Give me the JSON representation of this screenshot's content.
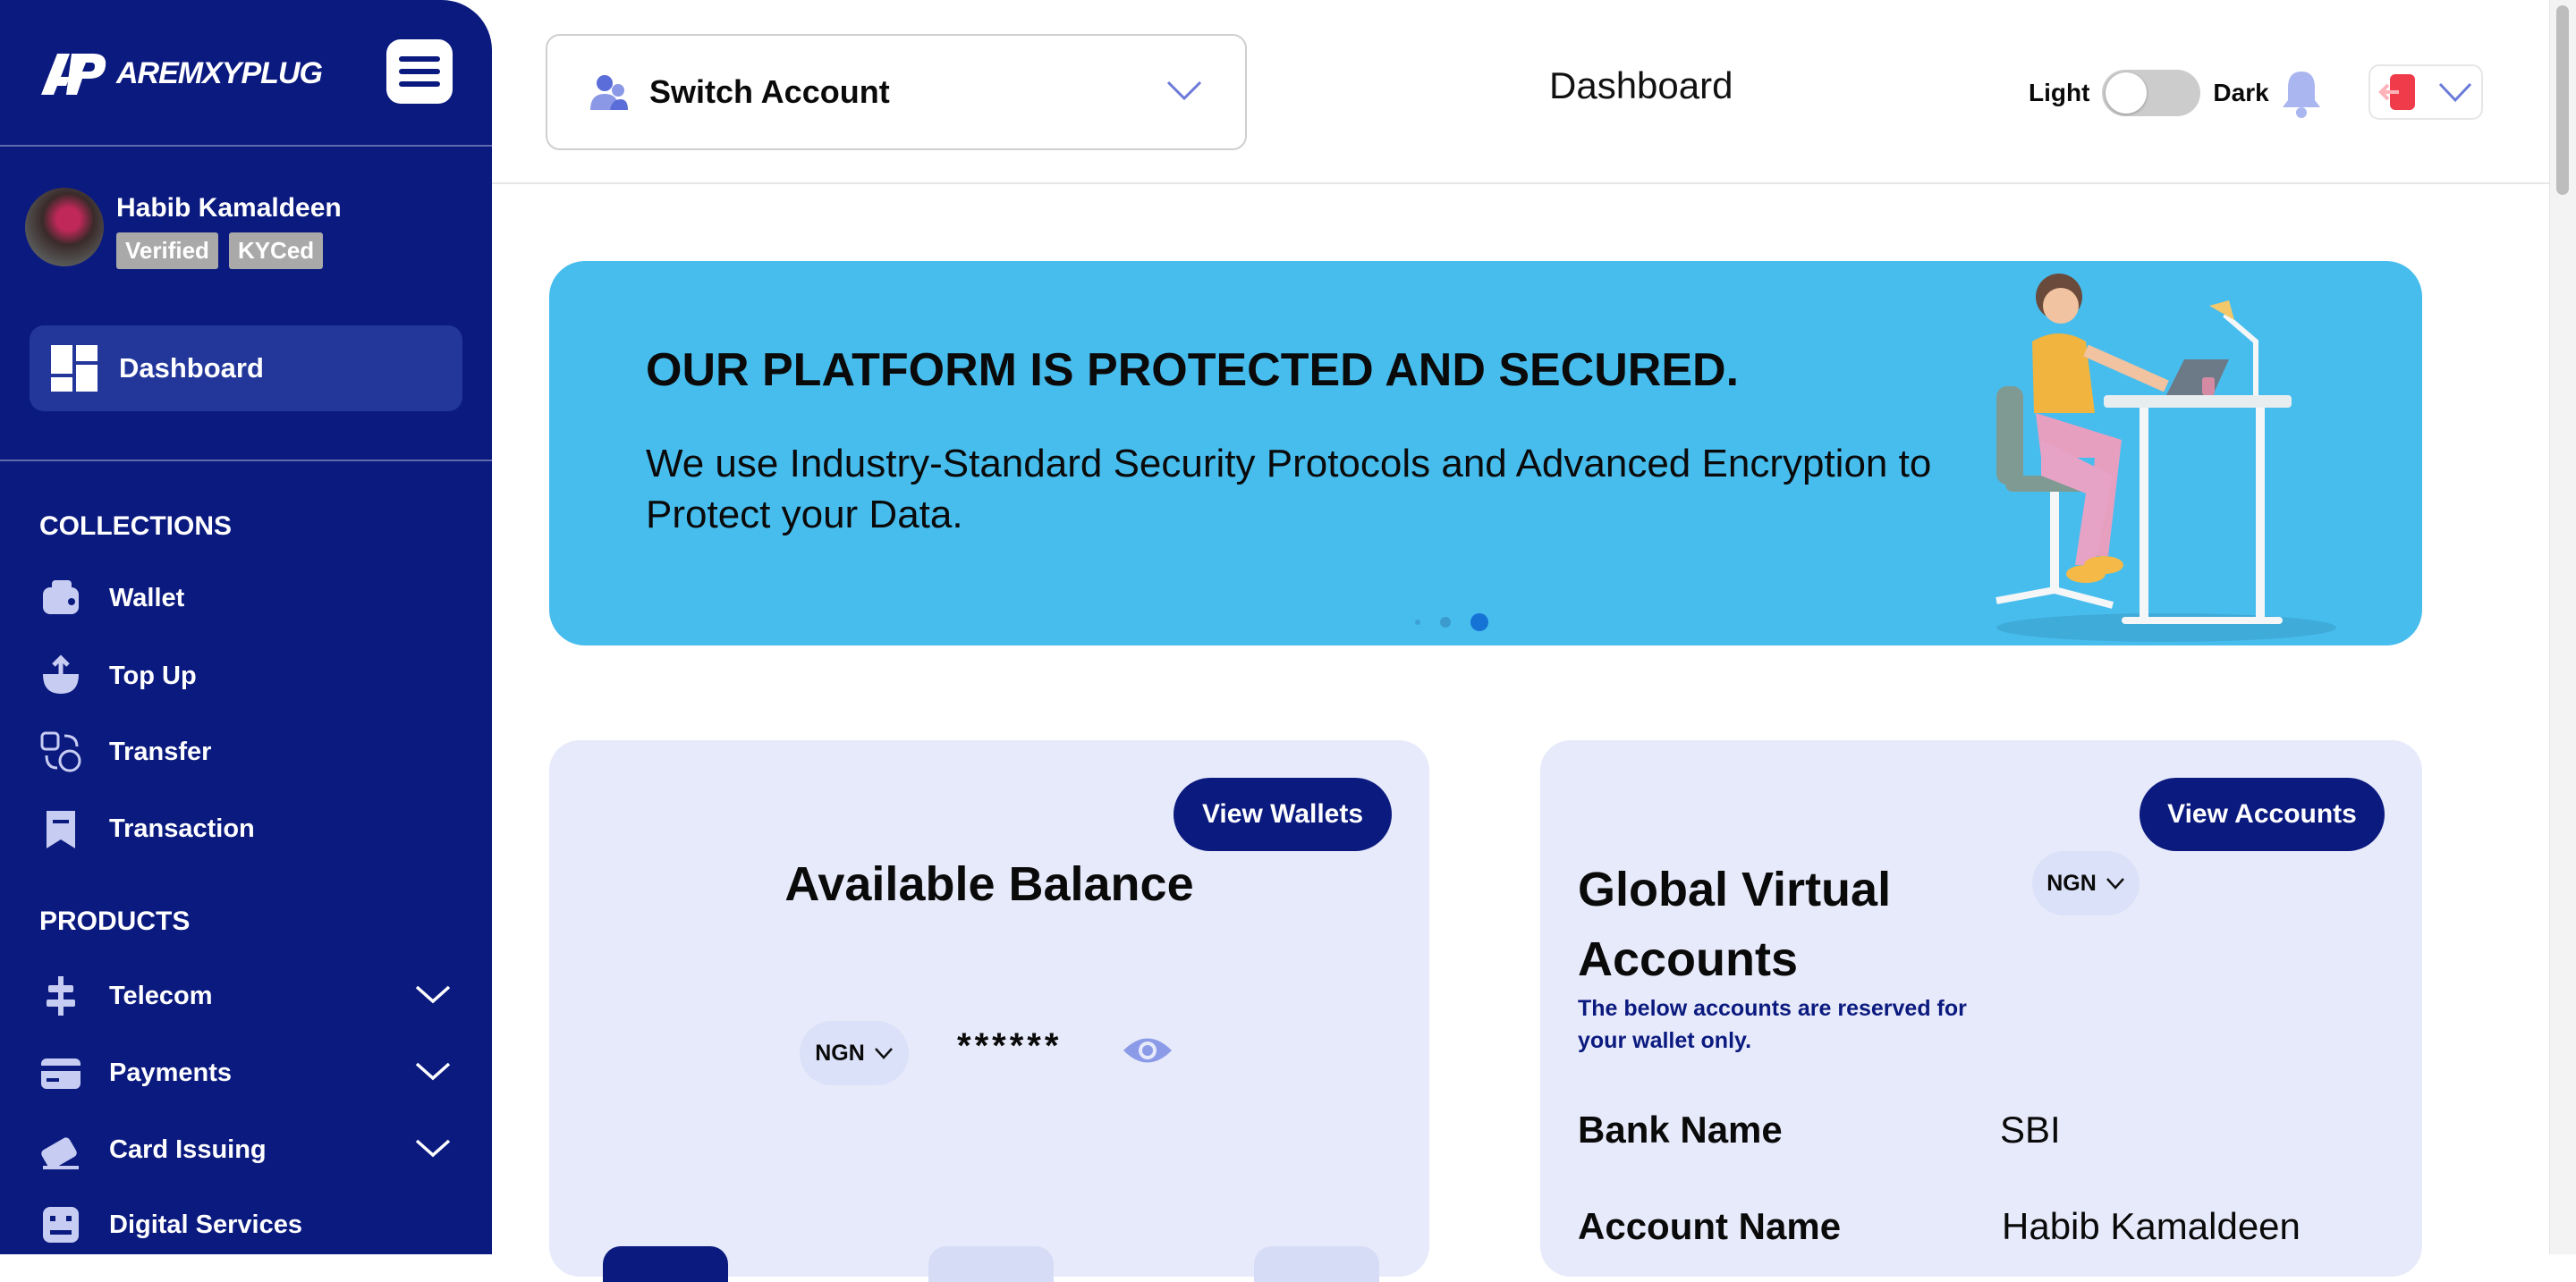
{
  "brand": {
    "name": "AREMXYPLUG"
  },
  "user": {
    "name": "Habib Kamaldeen",
    "badges": [
      "Verified",
      "KYCed"
    ]
  },
  "sidebar": {
    "active": {
      "label": "Dashboard"
    },
    "sections": [
      {
        "title": "COLLECTIONS",
        "items": [
          {
            "label": "Wallet",
            "icon": "wallet-icon"
          },
          {
            "label": "Top Up",
            "icon": "top-up-icon"
          },
          {
            "label": "Transfer",
            "icon": "transfer-icon"
          },
          {
            "label": "Transaction",
            "icon": "receipt-icon"
          }
        ]
      },
      {
        "title": "PRODUCTS",
        "items": [
          {
            "label": "Telecom",
            "icon": "telecom-icon",
            "expandable": true
          },
          {
            "label": "Payments",
            "icon": "card-icon",
            "expandable": true
          },
          {
            "label": "Card Issuing",
            "icon": "card-issue-icon",
            "expandable": true
          },
          {
            "label": "Digital Services",
            "icon": "digital-services-icon"
          }
        ]
      }
    ]
  },
  "header": {
    "switch_account_label": "Switch Account",
    "page_title": "Dashboard",
    "theme_light": "Light",
    "theme_dark": "Dark",
    "theme_mode": "light"
  },
  "banner": {
    "title": "OUR PLATFORM IS PROTECTED AND SECURED.",
    "text": "We use Industry-Standard Security Protocols and Advanced Encryption to Protect your Data.",
    "slide_count": 3,
    "active_slide": 3
  },
  "balance_card": {
    "button_label": "View Wallets",
    "title": "Available Balance",
    "currency": "NGN",
    "masked_amount": "******"
  },
  "accounts_card": {
    "button_label": "View Accounts",
    "title": "Global Virtual Accounts",
    "currency": "NGN",
    "subtitle": "The below accounts are reserved for your wallet only.",
    "rows": [
      {
        "label": "Bank Name",
        "value": "SBI"
      },
      {
        "label": "Account Name",
        "value": "Habib Kamaldeen"
      }
    ]
  },
  "colors": {
    "sidebar_bg": "#0b1a7f",
    "accent": "#0b1a7f",
    "banner_bg": "#47bdee",
    "card_bg": "#e7eafa"
  }
}
